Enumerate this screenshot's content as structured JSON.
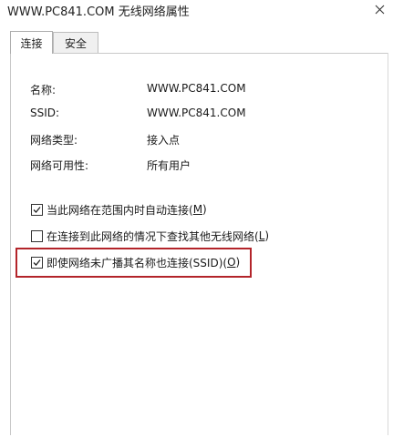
{
  "window": {
    "title": "WWW.PC841.COM 无线网络属性"
  },
  "tabs": [
    {
      "label": "连接",
      "active": true
    },
    {
      "label": "安全",
      "active": false
    }
  ],
  "properties": [
    {
      "label": "名称:",
      "value": "WWW.PC841.COM"
    },
    {
      "label": "SSID:",
      "value": "WWW.PC841.COM"
    },
    {
      "label": "网络类型:",
      "value": "接入点"
    },
    {
      "label": "网络可用性:",
      "value": "所有用户"
    }
  ],
  "options": [
    {
      "text": "当此网络在范围内时自动连接(",
      "key": "M",
      "suffix": ")",
      "checked": true
    },
    {
      "text": "在连接到此网络的情况下查找其他无线网络(",
      "key": "L",
      "suffix": ")",
      "checked": false
    },
    {
      "text": "即使网络未广播其名称也连接(SSID)(",
      "key": "O",
      "suffix": ")",
      "checked": true
    }
  ],
  "colors": {
    "highlight": "#b3242a"
  }
}
